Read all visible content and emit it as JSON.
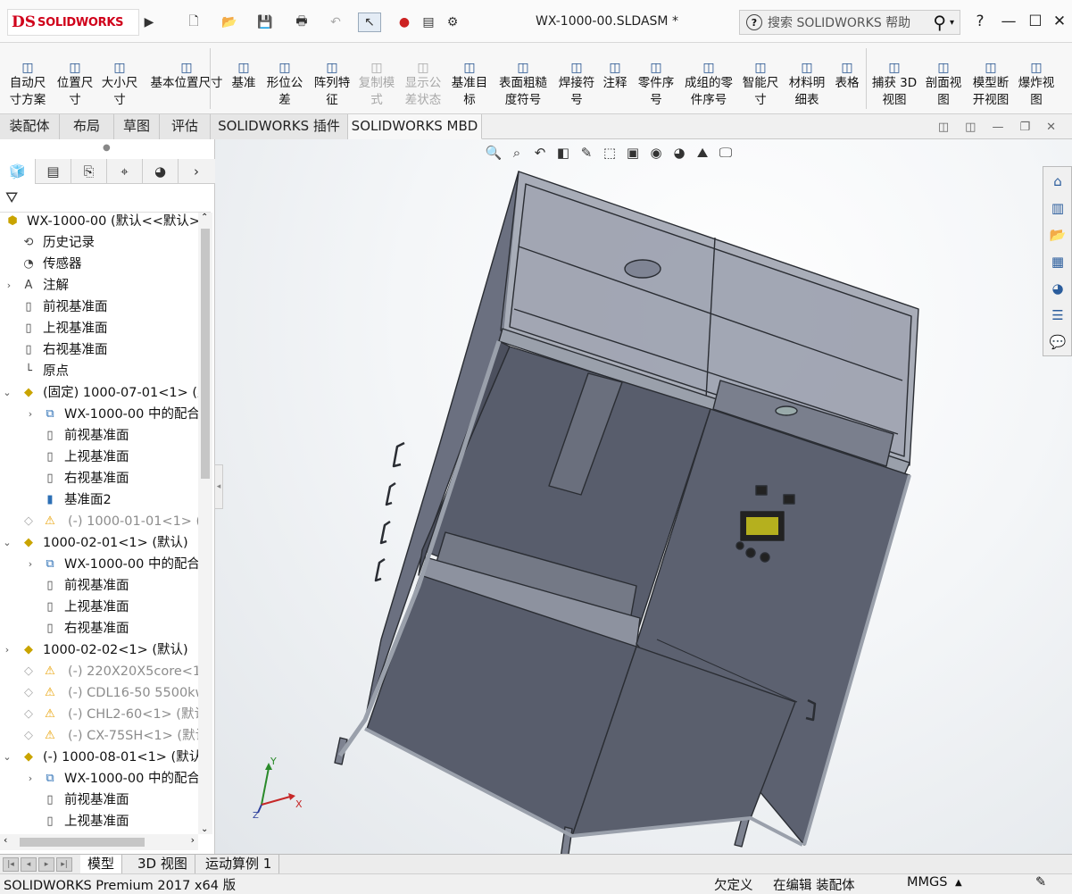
{
  "app": {
    "logo_mark": "DS",
    "logo_text": "SOLIDWORKS"
  },
  "document": {
    "title": "WX-1000-00.SLDASM *"
  },
  "search": {
    "placeholder": "搜索 SOLIDWORKS 帮助"
  },
  "window": {
    "help": "?"
  },
  "commands": [
    {
      "icon": "smart-dimension-auto-icon",
      "label": "自动尺\n寸方案",
      "disabled": false
    },
    {
      "icon": "location-dimension-icon",
      "label": "位置尺\n寸",
      "disabled": false
    },
    {
      "icon": "size-dimension-icon",
      "label": "大小尺\n寸",
      "disabled": false
    },
    {
      "icon": "basic-location-dimension-icon",
      "label": "基本位置尺寸",
      "disabled": false
    },
    {
      "icon": "datum-icon",
      "label": "基准",
      "disabled": false
    },
    {
      "icon": "geometric-tolerance-icon",
      "label": "形位公\n差",
      "disabled": false
    },
    {
      "icon": "pattern-feature-icon",
      "label": "阵列特\n征",
      "disabled": false
    },
    {
      "icon": "copy-scheme-icon",
      "label": "复制模\n式",
      "disabled": true
    },
    {
      "icon": "show-tolerance-status-icon",
      "label": "显示公\n差状态",
      "disabled": true
    },
    {
      "icon": "datum-target-icon",
      "label": "基准目\n标",
      "disabled": false
    },
    {
      "icon": "surface-finish-icon",
      "label": "表面粗糙\n度符号",
      "disabled": false
    },
    {
      "icon": "weld-symbol-icon",
      "label": "焊接符\n号",
      "disabled": false
    },
    {
      "icon": "note-icon",
      "label": "注释",
      "disabled": false
    },
    {
      "icon": "balloon-icon",
      "label": "零件序\n号",
      "disabled": false
    },
    {
      "icon": "stacked-balloon-icon",
      "label": "成组的零\n件序号",
      "disabled": false
    },
    {
      "icon": "smart-dimension-icon",
      "label": "智能尺\n寸",
      "disabled": false
    },
    {
      "icon": "bom-icon",
      "label": "材料明\n细表",
      "disabled": false
    },
    {
      "icon": "table-icon",
      "label": "表格",
      "disabled": false
    },
    {
      "icon": "capture-3d-view-icon",
      "label": "捕获 3D\n视图",
      "disabled": false
    },
    {
      "icon": "section-view-icon",
      "label": "剖面视\n图",
      "disabled": false
    },
    {
      "icon": "model-break-view-icon",
      "label": "模型断\n开视图",
      "disabled": false
    },
    {
      "icon": "exploded-view-icon",
      "label": "爆炸视\n图",
      "disabled": false
    }
  ],
  "tabs": [
    {
      "label": "装配体",
      "active": false
    },
    {
      "label": "布局",
      "active": false
    },
    {
      "label": "草图",
      "active": false
    },
    {
      "label": "评估",
      "active": false
    },
    {
      "label": "SOLIDWORKS 插件",
      "active": false
    },
    {
      "label": "SOLIDWORKS MBD",
      "active": true
    }
  ],
  "tree": [
    {
      "indent": 0,
      "expand": "",
      "icon": "assembly-icon",
      "label": "WX-1000-00  (默认<<默认>",
      "grey": false,
      "warn": false
    },
    {
      "indent": 1,
      "expand": "",
      "icon": "history-icon",
      "label": "历史记录",
      "grey": false,
      "warn": false
    },
    {
      "indent": 1,
      "expand": "",
      "icon": "sensor-icon",
      "label": "传感器",
      "grey": false,
      "warn": false
    },
    {
      "indent": 1,
      "expand": "›",
      "icon": "annotation-icon",
      "label": "注解",
      "grey": false,
      "warn": false
    },
    {
      "indent": 1,
      "expand": "",
      "icon": "plane-icon",
      "label": "前视基准面",
      "grey": false,
      "warn": false
    },
    {
      "indent": 1,
      "expand": "",
      "icon": "plane-icon",
      "label": "上视基准面",
      "grey": false,
      "warn": false
    },
    {
      "indent": 1,
      "expand": "",
      "icon": "plane-icon",
      "label": "右视基准面",
      "grey": false,
      "warn": false
    },
    {
      "indent": 1,
      "expand": "",
      "icon": "origin-icon",
      "label": "原点",
      "grey": false,
      "warn": false
    },
    {
      "indent": 0,
      "expand": "⌄",
      "icon": "part-icon",
      "label": "(固定) 1000-07-01<1> (默",
      "grey": false,
      "warn": false
    },
    {
      "indent": 2,
      "expand": "›",
      "icon": "mates-icon",
      "label": "WX-1000-00 中的配合",
      "grey": false,
      "warn": false
    },
    {
      "indent": 2,
      "expand": "",
      "icon": "plane-icon",
      "label": "前视基准面",
      "grey": false,
      "warn": false
    },
    {
      "indent": 2,
      "expand": "",
      "icon": "plane-icon",
      "label": "上视基准面",
      "grey": false,
      "warn": false
    },
    {
      "indent": 2,
      "expand": "",
      "icon": "plane-icon",
      "label": "右视基准面",
      "grey": false,
      "warn": false
    },
    {
      "indent": 2,
      "expand": "",
      "icon": "plane-blue-icon",
      "label": "基准面2",
      "grey": false,
      "warn": false
    },
    {
      "indent": 1,
      "expand": "",
      "icon": "part-suppressed-icon",
      "label": "(-) 1000-01-01<1> (默",
      "grey": true,
      "warn": true
    },
    {
      "indent": 0,
      "expand": "⌄",
      "icon": "part-icon",
      "label": "1000-02-01<1> (默认)",
      "grey": false,
      "warn": false
    },
    {
      "indent": 2,
      "expand": "›",
      "icon": "mates-icon",
      "label": "WX-1000-00 中的配合",
      "grey": false,
      "warn": false
    },
    {
      "indent": 2,
      "expand": "",
      "icon": "plane-icon",
      "label": "前视基准面",
      "grey": false,
      "warn": false
    },
    {
      "indent": 2,
      "expand": "",
      "icon": "plane-icon",
      "label": "上视基准面",
      "grey": false,
      "warn": false
    },
    {
      "indent": 2,
      "expand": "",
      "icon": "plane-icon",
      "label": "右视基准面",
      "grey": false,
      "warn": false
    },
    {
      "indent": 0,
      "expand": "›",
      "icon": "part-icon",
      "label": "1000-02-02<1> (默认)",
      "grey": false,
      "warn": false
    },
    {
      "indent": 1,
      "expand": "",
      "icon": "part-suppressed-icon",
      "label": "(-) 220X20X5core<1",
      "grey": true,
      "warn": true
    },
    {
      "indent": 1,
      "expand": "",
      "icon": "part-suppressed-icon",
      "label": "(-) CDL16-50 5500kw",
      "grey": true,
      "warn": true
    },
    {
      "indent": 1,
      "expand": "",
      "icon": "part-suppressed-icon",
      "label": "(-) CHL2-60<1> (默认",
      "grey": true,
      "warn": true
    },
    {
      "indent": 1,
      "expand": "",
      "icon": "part-suppressed-icon",
      "label": "(-) CX-75SH<1> (默认",
      "grey": true,
      "warn": true
    },
    {
      "indent": 0,
      "expand": "⌄",
      "icon": "part-icon",
      "label": "(-) 1000-08-01<1> (默认",
      "grey": false,
      "warn": false
    },
    {
      "indent": 2,
      "expand": "›",
      "icon": "mates-icon",
      "label": "WX-1000-00 中的配合",
      "grey": false,
      "warn": false
    },
    {
      "indent": 2,
      "expand": "",
      "icon": "plane-icon",
      "label": "前视基准面",
      "grey": false,
      "warn": false
    },
    {
      "indent": 2,
      "expand": "",
      "icon": "plane-icon",
      "label": "上视基准面",
      "grey": false,
      "warn": false
    }
  ],
  "bottom_tabs": [
    {
      "label": "模型",
      "active": true
    },
    {
      "label": "3D 视图",
      "active": false
    },
    {
      "label": "运动算例 1",
      "active": false
    }
  ],
  "status": {
    "product": "SOLIDWORKS Premium 2017 x64 版",
    "definition": "欠定义",
    "mode": "在编辑 装配体",
    "units": "MMGS"
  },
  "triad": {
    "y": "Y",
    "x": "X",
    "z": "Z"
  },
  "colors": {
    "model_body": "#5c6170",
    "accent_logo": "#d0021b"
  }
}
